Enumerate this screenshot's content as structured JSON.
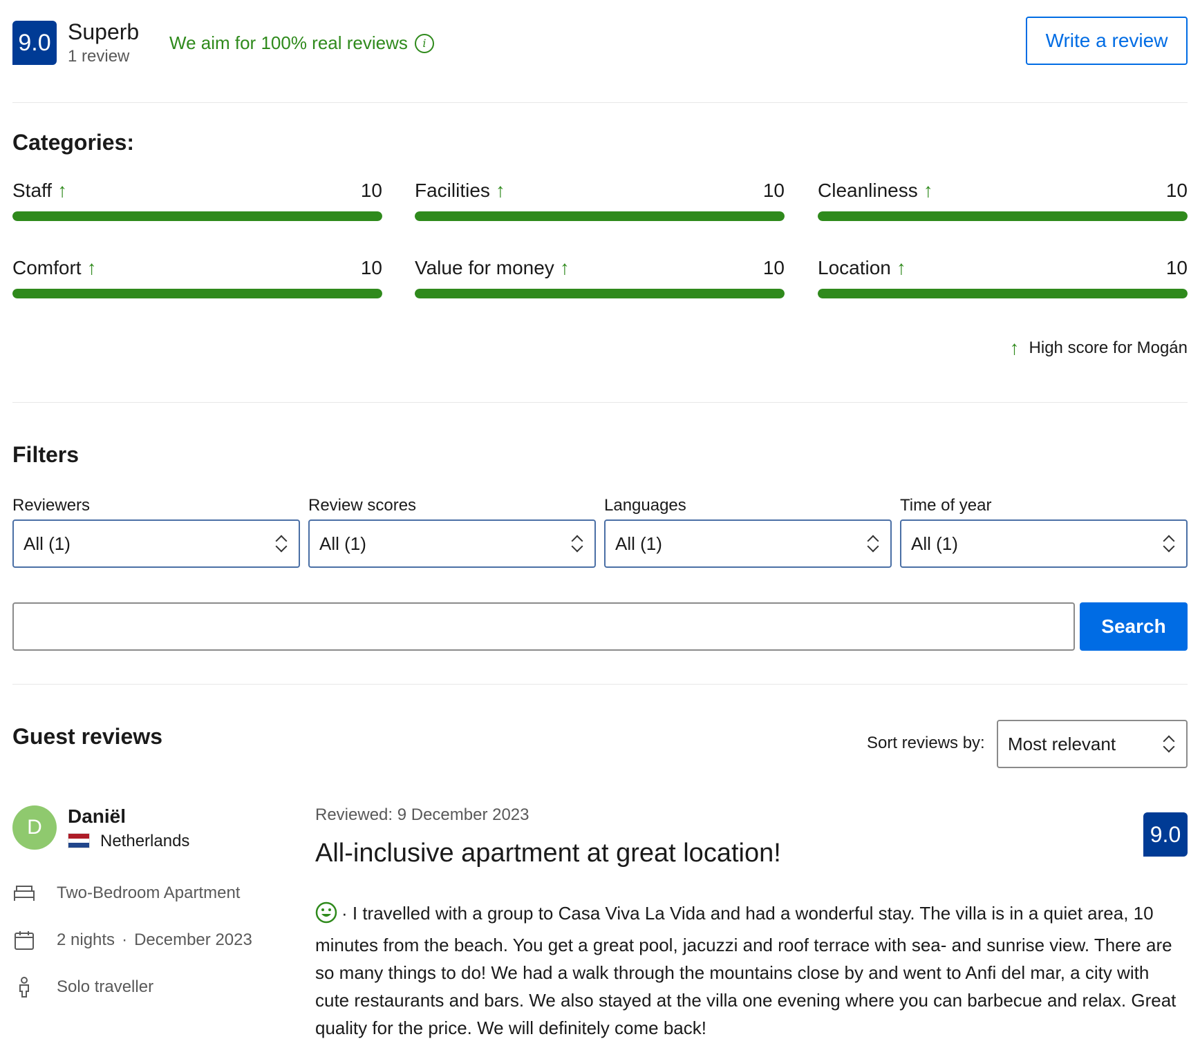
{
  "header": {
    "score": "9.0",
    "score_word": "Superb",
    "review_count": "1 review",
    "real_reviews_text": "We aim for 100% real reviews",
    "write_review_label": "Write a review"
  },
  "categories": {
    "title": "Categories:",
    "items": [
      {
        "name": "Staff",
        "score": "10",
        "fraction": 1.0
      },
      {
        "name": "Facilities",
        "score": "10",
        "fraction": 1.0
      },
      {
        "name": "Cleanliness",
        "score": "10",
        "fraction": 1.0
      },
      {
        "name": "Comfort",
        "score": "10",
        "fraction": 1.0
      },
      {
        "name": "Value for money",
        "score": "10",
        "fraction": 1.0
      },
      {
        "name": "Location",
        "score": "10",
        "fraction": 1.0
      }
    ],
    "high_score_note": "High score for Mogán",
    "bar_color": "#2f8a1c"
  },
  "filters": {
    "title": "Filters",
    "items": [
      {
        "label": "Reviewers",
        "value": "All (1)"
      },
      {
        "label": "Review scores",
        "value": "All (1)"
      },
      {
        "label": "Languages",
        "value": "All (1)"
      },
      {
        "label": "Time of year",
        "value": "All (1)"
      }
    ],
    "search_value": "",
    "search_button_label": "Search"
  },
  "guest_reviews": {
    "title": "Guest reviews",
    "sort_label": "Sort reviews by:",
    "sort_value": "Most relevant"
  },
  "review": {
    "avatar_letter": "D",
    "reviewer_name": "Daniël",
    "country": "Netherlands",
    "room_type": "Two-Bedroom Apartment",
    "nights": "2 nights",
    "stay_month": "December 2023",
    "traveller_type": "Solo traveller",
    "reviewed_date": "Reviewed: 9 December 2023",
    "title": "All-inclusive apartment at great location!",
    "score": "9.0",
    "body": "· I travelled with a group to Casa Viva La Vida and had a wonderful stay. The villa is in a quiet area, 10 minutes from the beach. You get a great pool, jacuzzi and roof terrace with sea- and sunrise view. There are so many things to do! We had a walk through the mountains close by and went to Anfi del mar, a city with cute restaurants and bars. We also stayed at the villa one evening where you can barbecue and relax. Great quality for the price. We will definitely come back!"
  },
  "icons": {
    "info": "info-icon",
    "arrow_up": "arrow-up-icon",
    "select": "chevron-up-down-icon",
    "bed": "bed-icon",
    "calendar": "calendar-icon",
    "person": "person-icon",
    "smile": "smiley-icon",
    "flag": "netherlands-flag-icon"
  },
  "colors": {
    "brand_dark_blue": "#003b95",
    "brand_blue": "#006ce4",
    "positive_green": "#2f8a1c"
  }
}
